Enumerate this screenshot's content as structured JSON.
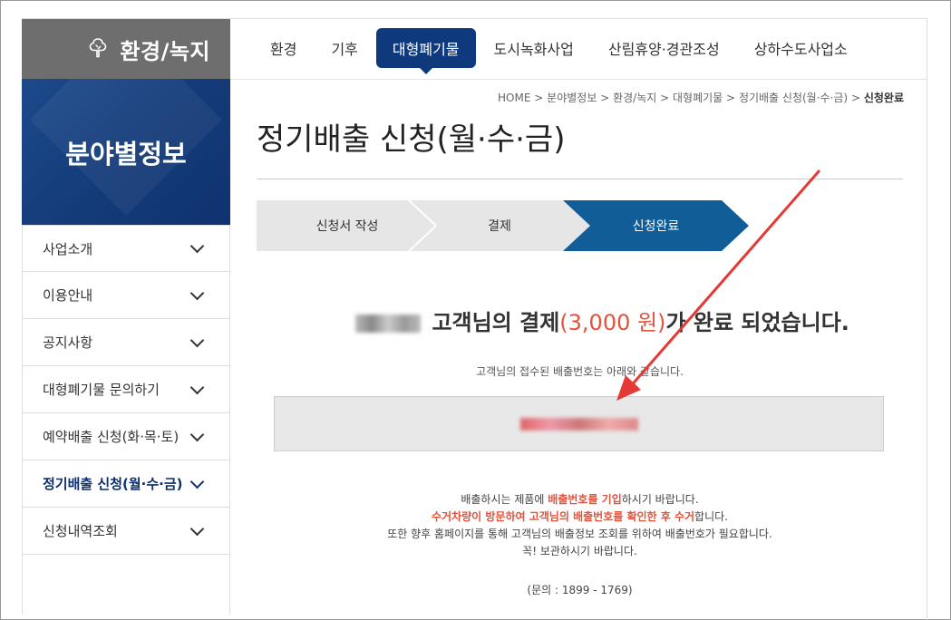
{
  "sidebar": {
    "brand": "환경/녹지",
    "hero_title": "분야별정보",
    "items": [
      {
        "label": "사업소개"
      },
      {
        "label": "이용안내"
      },
      {
        "label": "공지사항"
      },
      {
        "label": "대형폐기물 문의하기"
      },
      {
        "label": "예약배출 신청(화·목·토)"
      },
      {
        "label": "정기배출 신청(월·수·금)"
      },
      {
        "label": "신청내역조회"
      }
    ]
  },
  "nav": {
    "items": [
      "환경",
      "기후",
      "대형폐기물",
      "도시녹화사업",
      "산림휴양·경관조성",
      "상하수도사업소"
    ]
  },
  "breadcrumb": {
    "home": "HOME",
    "c1": "분야별정보",
    "c2": "환경/녹지",
    "c3": "대형폐기물",
    "c4": "정기배출 신청(월·수·금)",
    "current": "신청완료",
    "sep": ">"
  },
  "page": {
    "title": "정기배출 신청(월·수·금)"
  },
  "steps": [
    "신청서 작성",
    "결제",
    "신청완료"
  ],
  "result": {
    "msg_pre": "고객님의 결제",
    "amount": "(3,000 원)",
    "msg_post": "가 완료 되었습니다.",
    "sub": "고객님의 접수된 배출번호는 아래와 같습니다."
  },
  "notes": {
    "l1a": "배출하시는 제품에 ",
    "l1b": "배출번호를 기입",
    "l1c": "하시기 바랍니다.",
    "l2a": "수거차량이 방문하여 고객님의 배출번호를 확인한 후 수거",
    "l2b": "합니다.",
    "l3": "또한 향후 홈페이지를 통해 고객님의 배출정보 조회를 위하여 배출번호가 필요합니다.",
    "l4": "꼭! 보관하시기 바랍니다.",
    "contact": "(문의 : 1899 - 1769)"
  },
  "colors": {
    "accent": "#0e3a7d",
    "step_active": "#115d97",
    "highlight": "#e2533c",
    "annotation_arrow": "#e53935"
  }
}
